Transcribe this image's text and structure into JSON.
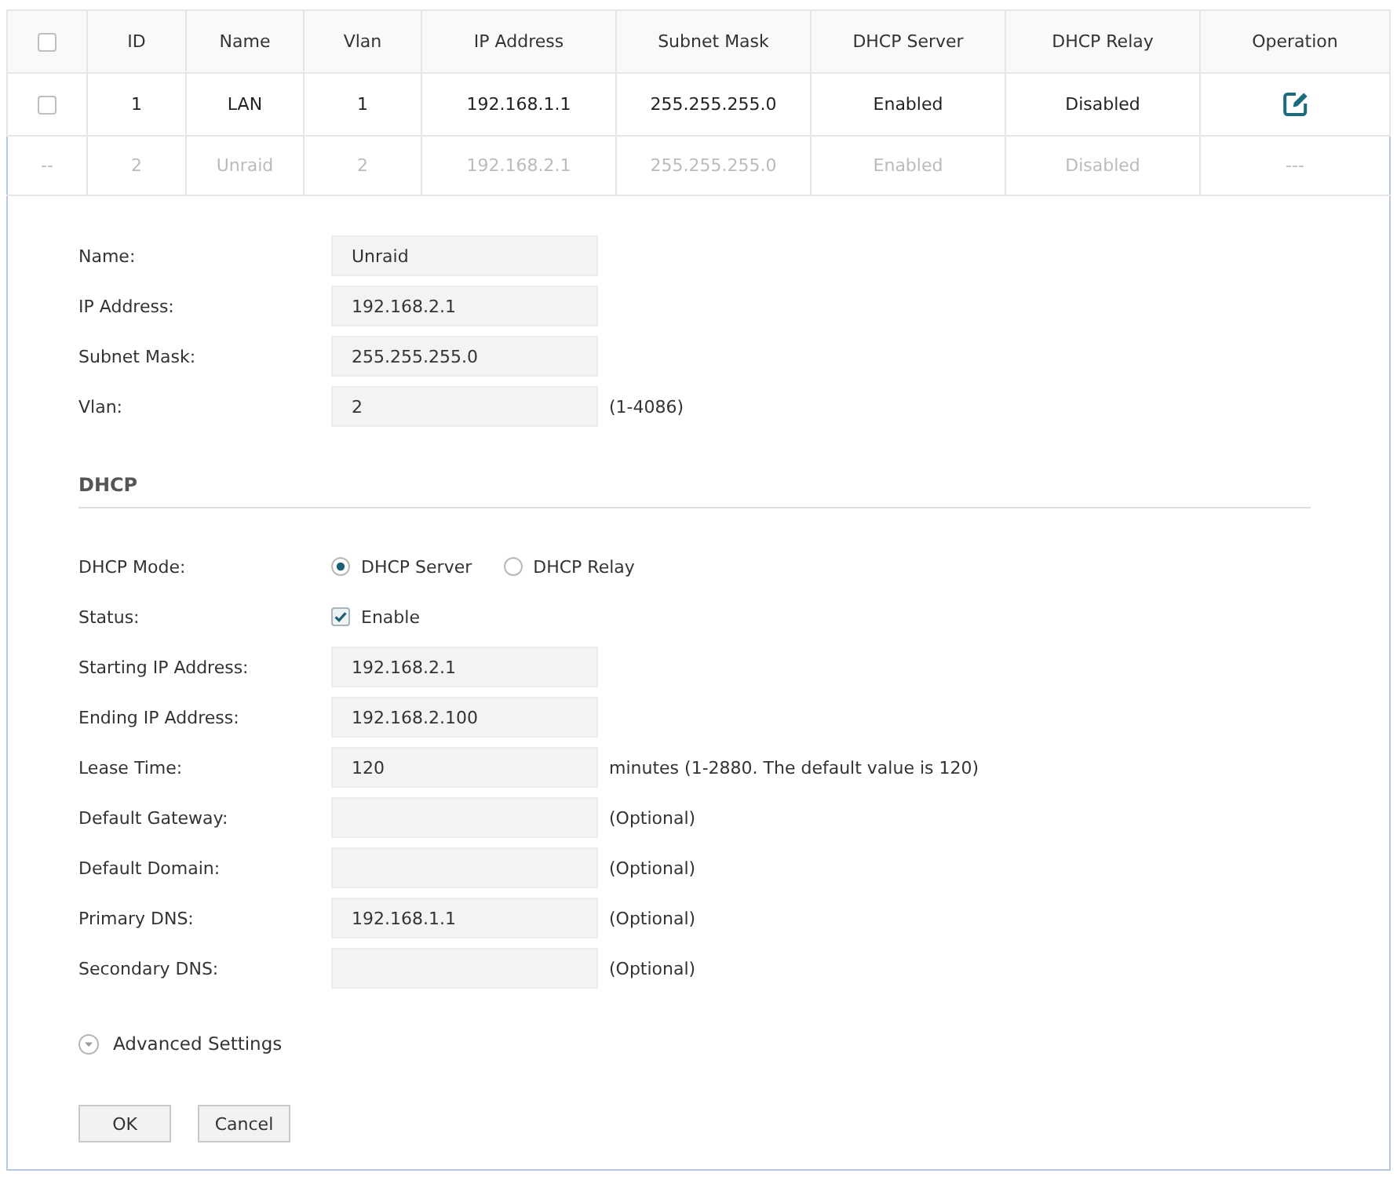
{
  "table": {
    "select_all": {
      "checked": false
    },
    "columns": [
      "ID",
      "Name",
      "Vlan",
      "IP Address",
      "Subnet Mask",
      "DHCP Server",
      "DHCP Relay",
      "Operation"
    ],
    "rows": [
      {
        "kind": "entry",
        "checked": false,
        "cells": [
          "1",
          "LAN",
          "1",
          "192.168.1.1",
          "255.255.255.0",
          "Enabled",
          "Disabled"
        ]
      },
      {
        "kind": "editing",
        "select": "--",
        "cells": [
          "2",
          "Unraid",
          "2",
          "192.168.2.1",
          "255.255.255.0",
          "Enabled",
          "Disabled"
        ],
        "operation": "---"
      }
    ]
  },
  "interface_form": {
    "fields": [
      {
        "label": "Name:",
        "value": "Unraid"
      },
      {
        "label": "IP Address:",
        "value": "192.168.2.1"
      },
      {
        "label": "Subnet Mask:",
        "value": "255.255.255.0"
      },
      {
        "label": "Vlan:",
        "value": "2",
        "hint": "(1-4086)"
      }
    ]
  },
  "dhcp": {
    "title": "DHCP",
    "rows": [
      {
        "kind": "radio",
        "label": "DHCP Mode:",
        "options": [
          {
            "label": "DHCP Server",
            "selected": true
          },
          {
            "label": "DHCP Relay",
            "selected": false
          }
        ]
      },
      {
        "kind": "checkbox",
        "label": "Status:",
        "option": "Enable",
        "checked": true
      },
      {
        "kind": "text",
        "label": "Starting IP Address:",
        "value": "192.168.2.1"
      },
      {
        "kind": "text",
        "label": "Ending IP Address:",
        "value": "192.168.2.100"
      },
      {
        "kind": "text",
        "label": "Lease Time:",
        "value": "120",
        "hint": "minutes (1-2880. The default value is 120)"
      },
      {
        "kind": "text",
        "label": "Default Gateway:",
        "hint": "(Optional)"
      },
      {
        "kind": "text",
        "label": "Default Domain:",
        "hint": "(Optional)"
      },
      {
        "kind": "text",
        "label": "Primary DNS:",
        "value": "192.168.1.1",
        "hint": "(Optional)"
      },
      {
        "kind": "text",
        "label": "Secondary DNS:",
        "hint": "(Optional)"
      }
    ]
  },
  "advanced_settings": {
    "label": "Advanced Settings",
    "expanded": false
  },
  "buttons": [
    {
      "label": "OK"
    },
    {
      "label": "Cancel"
    }
  ]
}
